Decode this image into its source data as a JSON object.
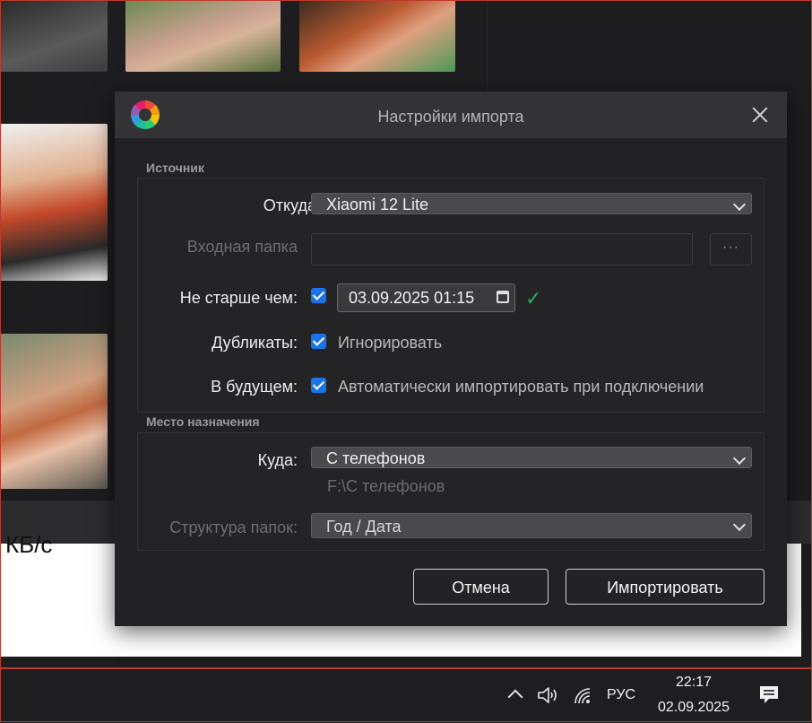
{
  "background": {
    "speed_text": "КБ/с"
  },
  "dialog": {
    "title": "Настройки импорта",
    "source": {
      "section_label": "Источник",
      "from_label": "Откуда:",
      "from_value": "Xiaomi 12 Lite",
      "input_folder_label": "Входная папка",
      "browse_label": "···",
      "not_older_label": "Не старше чем:",
      "not_older_checked": true,
      "not_older_value": "03.09.2025  01:15",
      "duplicates_label": "Дубликаты:",
      "duplicates_checked": true,
      "duplicates_option": "Игнорировать",
      "future_label": "В будущем:",
      "future_checked": true,
      "future_option": "Автоматически импортировать при подключении"
    },
    "destination": {
      "section_label": "Место назначения",
      "to_label": "Куда:",
      "to_value": "С телефонов",
      "to_path": "F:\\С телефонов",
      "structure_label": "Структура папок:",
      "structure_value": "Год / Дата"
    },
    "buttons": {
      "cancel": "Отмена",
      "import": "Импортировать"
    }
  },
  "taskbar": {
    "language": "РУС",
    "time": "22:17",
    "date": "02.09.2025"
  },
  "colors": {
    "accent_checkbox": "#1a73e8",
    "valid_check": "#27ae60"
  }
}
